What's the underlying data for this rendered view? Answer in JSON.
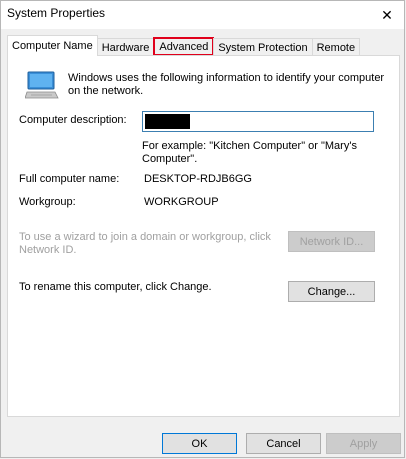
{
  "window": {
    "title": "System Properties",
    "close_glyph": "✕"
  },
  "tabs": [
    {
      "label": "Computer Name",
      "active": true
    },
    {
      "label": "Hardware"
    },
    {
      "label": "Advanced",
      "highlighted": true
    },
    {
      "label": "System Protection"
    },
    {
      "label": "Remote"
    }
  ],
  "computer_name_tab": {
    "intro": "Windows uses the following information to identify your computer on the network.",
    "description_label": "Computer description:",
    "description_value": "",
    "example_text": "For example: \"Kitchen Computer\" or \"Mary's Computer\".",
    "full_name_label": "Full computer name:",
    "full_name_value": "DESKTOP-RDJB6GG",
    "workgroup_label": "Workgroup:",
    "workgroup_value": "WORKGROUP",
    "network_id_text": "To use a wizard to join a domain or workgroup, click Network ID.",
    "network_id_button": "Network ID...",
    "rename_text": "To rename this computer, click Change.",
    "change_button": "Change..."
  },
  "footer": {
    "ok": "OK",
    "cancel": "Cancel",
    "apply": "Apply"
  },
  "icons": {
    "computer": "computer-icon",
    "close": "close-icon"
  },
  "colors": {
    "highlight": "#e0001b",
    "focus_border": "#3c7fb1",
    "default_button_border": "#0078d7"
  }
}
